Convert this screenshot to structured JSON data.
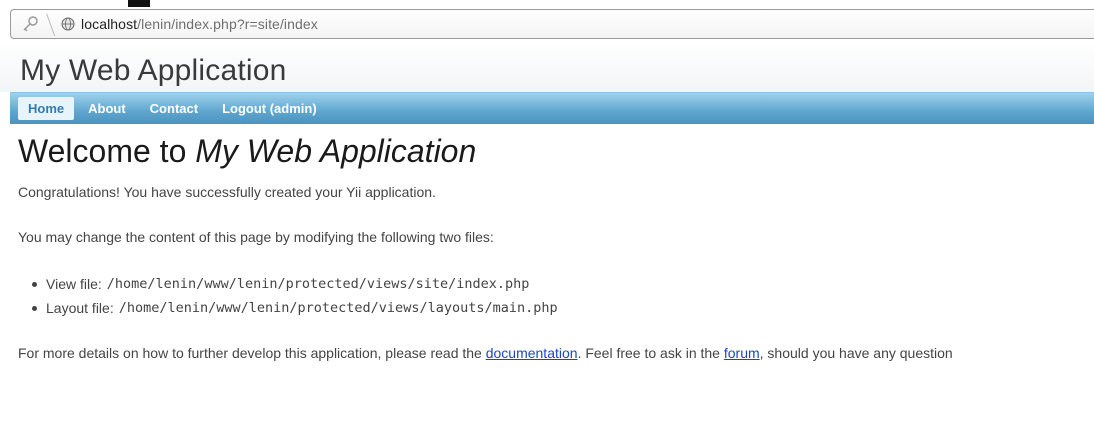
{
  "browser": {
    "url_host": "localhost",
    "url_path": "/lenin/index.php?r=site/index"
  },
  "app": {
    "title": "My Web Application"
  },
  "menu": {
    "items": [
      {
        "label": "Home",
        "active": true
      },
      {
        "label": "About",
        "active": false
      },
      {
        "label": "Contact",
        "active": false
      },
      {
        "label": "Logout (admin)",
        "active": false
      }
    ]
  },
  "content": {
    "heading_prefix": "Welcome to ",
    "heading_app": "My Web Application",
    "congrats": "Congratulations! You have successfully created your Yii application.",
    "change_info": "You may change the content of this page by modifying the following two files:",
    "files": [
      {
        "label": "View file:",
        "path": "/home/lenin/www/lenin/protected/views/site/index.php"
      },
      {
        "label": "Layout file:",
        "path": "/home/lenin/www/lenin/protected/views/layouts/main.php"
      }
    ],
    "more_prefix": "For more details on how to further develop this application, please read the ",
    "documentation_link": "documentation",
    "more_mid": ". Feel free to ask in the ",
    "forum_link": "forum",
    "more_suffix": ", should you have any question"
  },
  "colors": {
    "menu_bar": "#5ea6cf",
    "link": "#1a46c2"
  }
}
